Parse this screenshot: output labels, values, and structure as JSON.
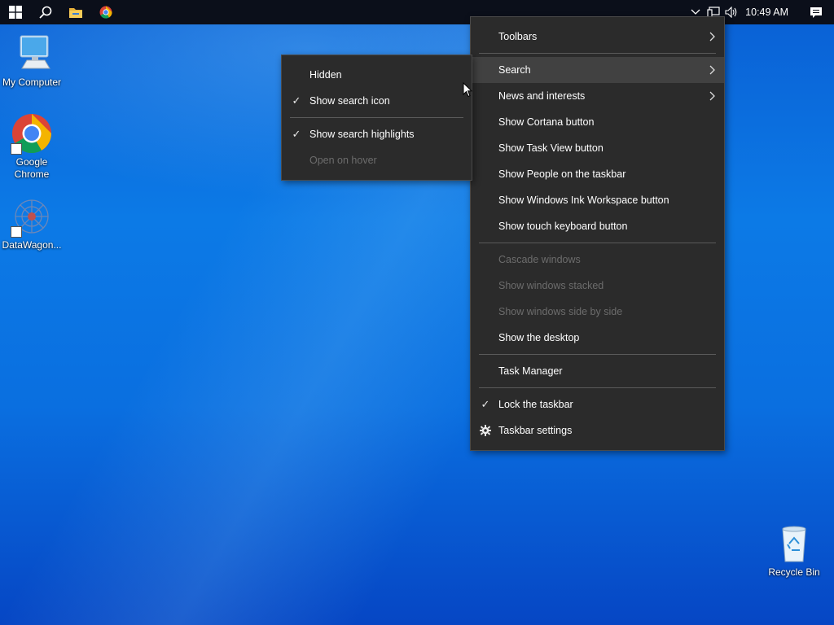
{
  "taskbar": {
    "icons": [
      "windows-start-icon",
      "search-icon",
      "file-explorer-icon",
      "chrome-icon"
    ],
    "tray": {
      "icons": [
        "chevron-up-icon",
        "network-icon",
        "volume-icon"
      ],
      "time": "10:49 AM"
    }
  },
  "desktop": {
    "icons": [
      {
        "label": "My Computer"
      },
      {
        "label": "Google Chrome"
      },
      {
        "label": "DataWagon..."
      },
      {
        "label": "Recycle Bin"
      }
    ]
  },
  "context_menu": {
    "items": [
      {
        "label": "Toolbars",
        "submenu": true
      },
      {
        "label": "Search",
        "submenu": true,
        "highlighted": true
      },
      {
        "label": "News and interests",
        "submenu": true
      },
      {
        "label": "Show Cortana button"
      },
      {
        "label": "Show Task View button"
      },
      {
        "label": "Show People on the taskbar"
      },
      {
        "label": "Show Windows Ink Workspace button"
      },
      {
        "label": "Show touch keyboard button"
      },
      {
        "label": "Cascade windows",
        "disabled": true
      },
      {
        "label": "Show windows stacked",
        "disabled": true
      },
      {
        "label": "Show windows side by side",
        "disabled": true
      },
      {
        "label": "Show the desktop"
      },
      {
        "label": "Task Manager"
      },
      {
        "label": "Lock the taskbar",
        "checked": true
      },
      {
        "label": "Taskbar settings",
        "icon": "gear-icon"
      }
    ]
  },
  "search_submenu": {
    "items": [
      {
        "label": "Hidden"
      },
      {
        "label": "Show search icon",
        "checked": true
      },
      {
        "label": "Show search highlights",
        "checked": true
      },
      {
        "label": "Open on hover",
        "disabled": true
      }
    ]
  },
  "colors": {
    "menu_bg": "#2b2b2b",
    "menu_hover": "#414141",
    "taskbar_bg": "#0b0f1a",
    "desktop_blue": "#0a6fe0"
  }
}
